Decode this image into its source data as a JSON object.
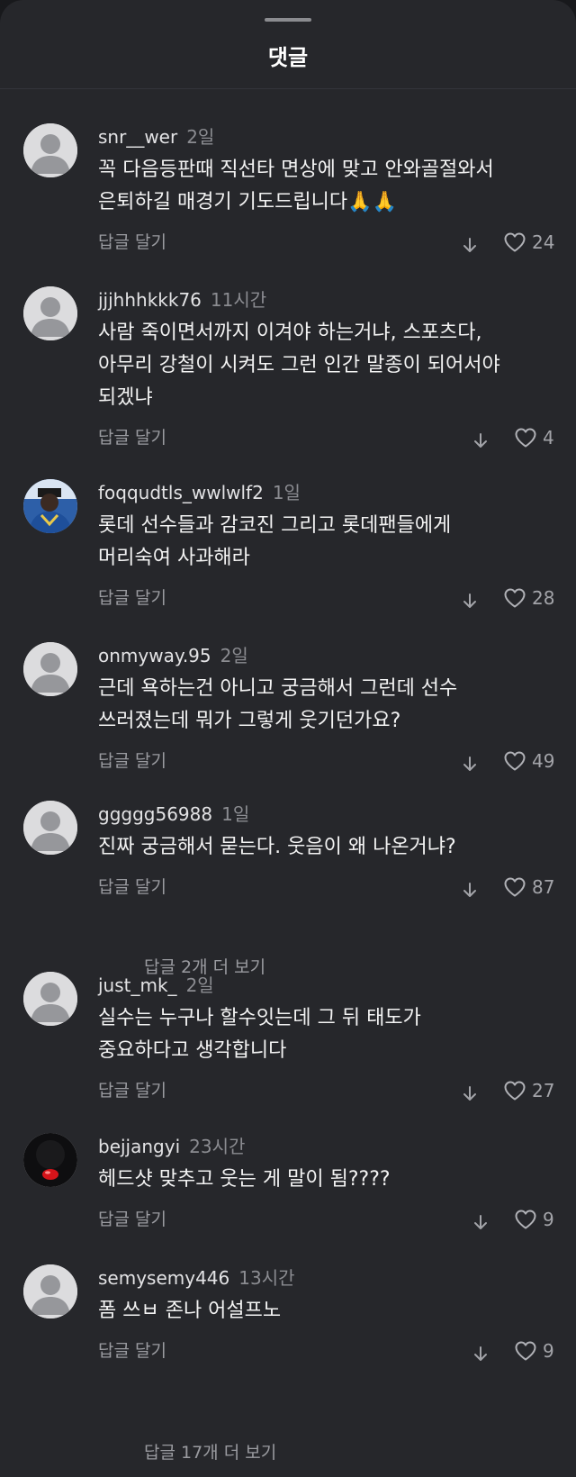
{
  "sheet": {
    "title": "댓글"
  },
  "reply_label": "답글 달기",
  "comments": [
    {
      "username": "snr__wer",
      "time": "2일",
      "text": [
        "꼭 다음등판때 직선타 면상에 맞고 안와골절와서",
        "은퇴하길 매경기 기도드립니다🙏🙏"
      ],
      "likes": "24",
      "avatar": "default"
    },
    {
      "username": "jjjhhhkkk76",
      "time": "11시간",
      "text": [
        "사람 죽이면서까지 이겨야 하는거냐, 스포츠다,",
        "아무리 강철이 시켜도 그런 인간 말종이 되어서야",
        "되겠냐"
      ],
      "likes": "4",
      "avatar": "default"
    },
    {
      "username": "foqqudtls_wwlwlf2",
      "time": "1일",
      "text": [
        "롯데 선수들과 감코진 그리고 롯데팬들에게",
        "머리숙여 사과해라"
      ],
      "likes": "28",
      "avatar": "photo-blue"
    },
    {
      "username": "onmyway.95",
      "time": "2일",
      "text": [
        "근데 욕하는건 아니고 궁금해서 그런데 선수",
        "쓰러졌는데 뭐가 그렇게 웃기던가요?"
      ],
      "likes": "49",
      "avatar": "default"
    },
    {
      "username": "ggggg56988",
      "time": "1일",
      "text": [
        "진짜 궁금해서 묻는다. 웃음이 왜 나온거냐?"
      ],
      "likes": "87",
      "avatar": "default",
      "more_replies": "답글 2개 더 보기"
    },
    {
      "username": "just_mk_",
      "time": "2일",
      "text": [
        "실수는 누구나 할수잇는데 그 뒤 태도가",
        "중요하다고 생각합니다"
      ],
      "likes": "27",
      "avatar": "default"
    },
    {
      "username": "bejjangyi",
      "time": "23시간",
      "text": [
        "헤드샷 맞추고  웃는 게 말이 됨????"
      ],
      "likes": "9",
      "avatar": "photo-dark"
    },
    {
      "username": "semysemy446",
      "time": "13시간",
      "text": [
        "폼 쓰ㅂ 존나 어설프노"
      ],
      "likes": "9",
      "avatar": "default",
      "more_replies": "답글 17개 더 보기"
    }
  ],
  "colors": {
    "background": "#26272b",
    "text": "#f3f3f3",
    "muted": "#9a9ba0",
    "avatar_default": "#dcdcde"
  },
  "icons": {
    "download": "download-arrow-icon",
    "like": "heart-outline-icon"
  }
}
